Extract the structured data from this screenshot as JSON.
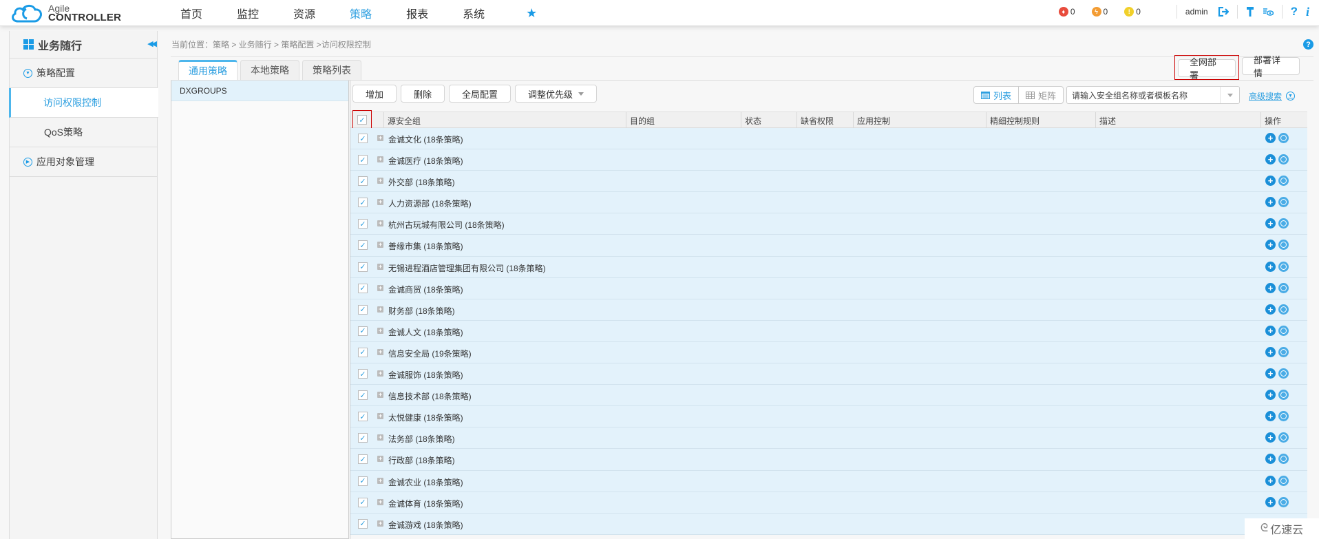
{
  "app": {
    "logo_line1": "Agile",
    "logo_line2": "CONTROLLER"
  },
  "nav": {
    "items": [
      {
        "label": "首页",
        "active": false
      },
      {
        "label": "监控",
        "active": false
      },
      {
        "label": "资源",
        "active": false
      },
      {
        "label": "策略",
        "active": true
      },
      {
        "label": "报表",
        "active": false
      },
      {
        "label": "系统",
        "active": false
      }
    ],
    "favorites_icon": "★"
  },
  "top_right": {
    "alarms": [
      {
        "name": "critical",
        "count": "0",
        "color": "#e84c3d",
        "glyph": "♦"
      },
      {
        "name": "major",
        "count": "0",
        "color": "#f39c33",
        "glyph": "ϟ"
      },
      {
        "name": "minor",
        "count": "0",
        "color": "#f1d02a",
        "glyph": "!"
      }
    ],
    "username": "admin",
    "help_glyph": "?",
    "info_glyph": "i"
  },
  "sidebar": {
    "title": "业务随行",
    "groups": [
      {
        "label": "策略配置",
        "expanded": true,
        "items": [
          {
            "label": "访问权限控制",
            "active": true
          },
          {
            "label": "QoS策略",
            "active": false
          }
        ]
      },
      {
        "label": "应用对象管理",
        "expanded": false,
        "items": []
      }
    ]
  },
  "breadcrumb": "当前位置：策略 > 业务随行 > 策略配置 >访问权限控制",
  "tabs": [
    {
      "label": "通用策略",
      "active": true
    },
    {
      "label": "本地策略",
      "active": false
    },
    {
      "label": "策略列表",
      "active": false
    }
  ],
  "deploy": {
    "deploy_all_label": "全网部署",
    "deploy_detail_label": "部署详情"
  },
  "left_panel": {
    "items": [
      "DXGROUPS"
    ]
  },
  "toolbar": {
    "add_label": "增加",
    "delete_label": "删除",
    "global_config_label": "全局配置",
    "priority_label": "调整优先级",
    "view_list_label": "列表",
    "view_matrix_label": "矩阵",
    "search_placeholder": "请输入安全组名称或者模板名称",
    "advanced_search_label": "高级搜索"
  },
  "table": {
    "columns": [
      "源安全组",
      "目的组",
      "状态",
      "缺省权限",
      "应用控制",
      "精细控制规则",
      "描述",
      "操作"
    ],
    "header_checked": true,
    "rows": [
      {
        "name": "金诚文化 (18条策略)",
        "checked": true
      },
      {
        "name": "金诚医疗 (18条策略)",
        "checked": true
      },
      {
        "name": "外交部 (18条策略)",
        "checked": true
      },
      {
        "name": "人力资源部 (18条策略)",
        "checked": true
      },
      {
        "name": "杭州古玩城有限公司 (18条策略)",
        "checked": true
      },
      {
        "name": "善缘市集 (18条策略)",
        "checked": true
      },
      {
        "name": "无锡进程酒店管理集团有限公司 (18条策略)",
        "checked": true
      },
      {
        "name": "金诚商贸 (18条策略)",
        "checked": true
      },
      {
        "name": "财务部 (18条策略)",
        "checked": true
      },
      {
        "name": "金诚人文 (18条策略)",
        "checked": true
      },
      {
        "name": "信息安全局 (19条策略)",
        "checked": true
      },
      {
        "name": "金诚服饰 (18条策略)",
        "checked": true
      },
      {
        "name": "信息技术部 (18条策略)",
        "checked": true
      },
      {
        "name": "太悦健康 (18条策略)",
        "checked": true
      },
      {
        "name": "法务部 (18条策略)",
        "checked": true
      },
      {
        "name": "行政部 (18条策略)",
        "checked": true
      },
      {
        "name": "金诚农业 (18条策略)",
        "checked": true
      },
      {
        "name": "金诚体育 (18条策略)",
        "checked": true
      },
      {
        "name": "金诚游戏 (18条策略)",
        "checked": true
      }
    ]
  },
  "watermark": "亿速云",
  "colors": {
    "accent": "#2d9fe0",
    "row_bg": "#e3f2fb",
    "highlight_border": "#cc0000"
  }
}
